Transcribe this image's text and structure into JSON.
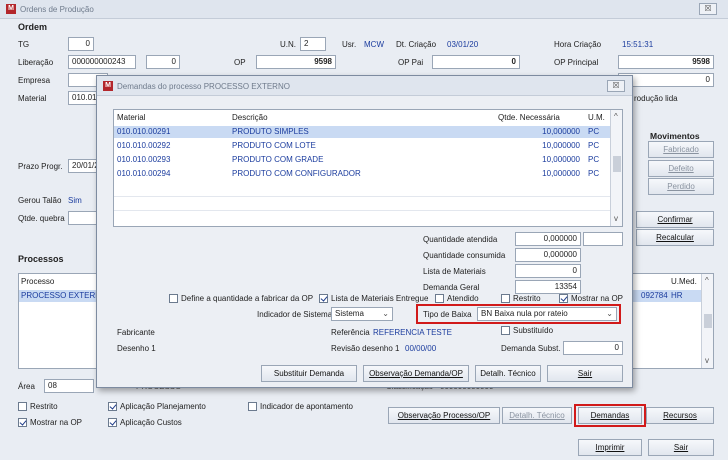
{
  "window": {
    "title": "Ordens de Produção",
    "close": "☒"
  },
  "ordem": {
    "section": "Ordem",
    "tg_label": "TG",
    "tg_value": "0",
    "un_label": "U.N.",
    "un_value": "2",
    "usr_label": "Usr.",
    "usr_value": "MCW",
    "dt_criacao_label": "Dt. Criação",
    "dt_criacao_value": "03/01/20",
    "hora_criacao_label": "Hora Criação",
    "hora_criacao_value": "15:51:31",
    "liberacao_label": "Liberação",
    "liberacao_value": "000000000243",
    "liberacao_seq": "0",
    "op_label": "OP",
    "op_value": "9598",
    "op_pai_label": "OP Pai",
    "op_pai_value": "0",
    "op_principal_label": "OP Principal",
    "op_principal_value": "9598",
    "empresa_label": "Empresa",
    "empresa_right_value": "0",
    "material_label": "Material",
    "material_value": "010.01",
    "producao_lida_label": "rodução lida",
    "prazo_label": "Prazo Progr.",
    "prazo_value": "20/01/2",
    "gerou_talao_label": "Gerou Talão",
    "gerou_talao_value": "Sim",
    "qtde_quebra_label": "Qtde. quebra"
  },
  "movimentos": {
    "title": "Movimentos",
    "fabricado": "Fabricado",
    "defeito": "Defeito",
    "perdido": "Perdido",
    "confirmar": "Confirmar",
    "recalcular": "Recalcular"
  },
  "processos": {
    "section": "Processos",
    "col_processo": "Processo",
    "col_umed": "U.Med.",
    "row_processo": "PROCESSO EXTERNO",
    "row_code": "092784",
    "row_umed": "HR"
  },
  "bottom": {
    "area_label": "Área",
    "area_value": "08",
    "area_desc": "PROCESSO",
    "classificacao_label": "Classificação",
    "classificacao_value": "000000000000",
    "restrito": "Restrito",
    "mostrar_na_op": "Mostrar na OP",
    "aplicacao_planejamento": "Aplicação Planejamento",
    "aplicacao_custos": "Aplicação Custos",
    "indicador_apontamento": "Indicador de apontamento",
    "btn_obs_processo": "Observação Processo/OP",
    "btn_detalh_tecnico": "Detalh. Técnico",
    "btn_demandas": "Demandas",
    "btn_recursos": "Recursos",
    "btn_imprimir": "Imprimir",
    "btn_sair": "Sair"
  },
  "dialog": {
    "title": "Demandas do processo PROCESSO EXTERNO",
    "close": "☒",
    "columns": {
      "material": "Material",
      "descricao": "Descrição",
      "qtde": "Qtde. Necessária",
      "um": "U.M."
    },
    "rows": [
      {
        "material": "010.010.00291",
        "descricao": "PRODUTO SIMPLES",
        "qtde": "10,000000",
        "um": "PC"
      },
      {
        "material": "010.010.00292",
        "descricao": "PRODUTO COM LOTE",
        "qtde": "10,000000",
        "um": "PC"
      },
      {
        "material": "010.010.00293",
        "descricao": "PRODUTO COM GRADE",
        "qtde": "10,000000",
        "um": "PC"
      },
      {
        "material": "010.010.00294",
        "descricao": "PRODUTO COM CONFIGURADOR",
        "qtde": "10,000000",
        "um": "PC"
      }
    ],
    "qtd_atendida_label": "Quantidade atendida",
    "qtd_atendida_value": "0,000000",
    "qtd_consumida_label": "Quantidade consumida",
    "qtd_consumida_value": "0,000000",
    "lista_materiais_label": "Lista de Materiais",
    "lista_materiais_value": "0",
    "demanda_geral_label": "Demanda Geral",
    "demanda_geral_value": "13354",
    "define_qtd": "Define a quantidade a fabricar da OP",
    "lista_entregue": "Lista de Materiais Entregue",
    "atendido": "Atendido",
    "restrito": "Restrito",
    "mostrar_na_op": "Mostrar na OP",
    "indicador_sistema_label": "Indicador de Sistema",
    "indicador_sistema_value": "Sistema",
    "tipo_baixa_label": "Tipo de Baixa",
    "tipo_baixa_value": "BN Baixa nula por rateio",
    "fabricante_label": "Fabricante",
    "referencia_label": "Referência",
    "referencia_value": "REFERENCIA TESTE",
    "substituido": "Substituído",
    "desenho_label": "Desenho 1",
    "revisao_label": "Revisão desenho 1",
    "revisao_value": "00/00/00",
    "demanda_subst_label": "Demanda Subst.",
    "demanda_subst_value": "0",
    "btn_substituir": "Substituir Demanda",
    "btn_observacao": "Observação Demanda/OP",
    "btn_detalh": "Detalh. Técnico",
    "btn_sair": "Sair"
  }
}
